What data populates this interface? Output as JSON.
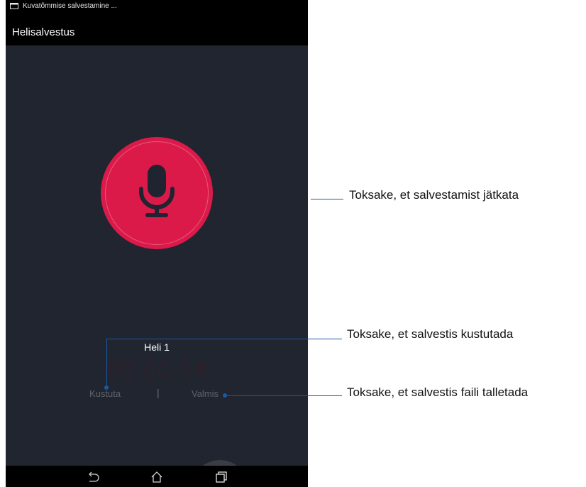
{
  "status_bar": {
    "notification_text": "Kuvatõmmise salvestamine ..."
  },
  "app_bar": {
    "title": "Helisalvestus"
  },
  "recorder": {
    "file_name": "Heli 1",
    "elapsed_time": "00:00:04",
    "delete_label": "Kustuta",
    "divider": "|",
    "done_label": "Valmis"
  },
  "callouts": {
    "record": "Toksake, et salvestamist jätkata",
    "delete": "Toksake, et salvestis kustutada",
    "done": "Toksake, et salvestis faili talletada"
  },
  "icons": {
    "status": "image-notification-icon",
    "record": "microphone-icon",
    "nav_back": "back-icon",
    "nav_home": "home-icon",
    "nav_recents": "recent-apps-icon"
  },
  "colors": {
    "record_button": "#db1a4a",
    "screen_background": "#20252f",
    "callout_line": "#1a5aa0"
  }
}
